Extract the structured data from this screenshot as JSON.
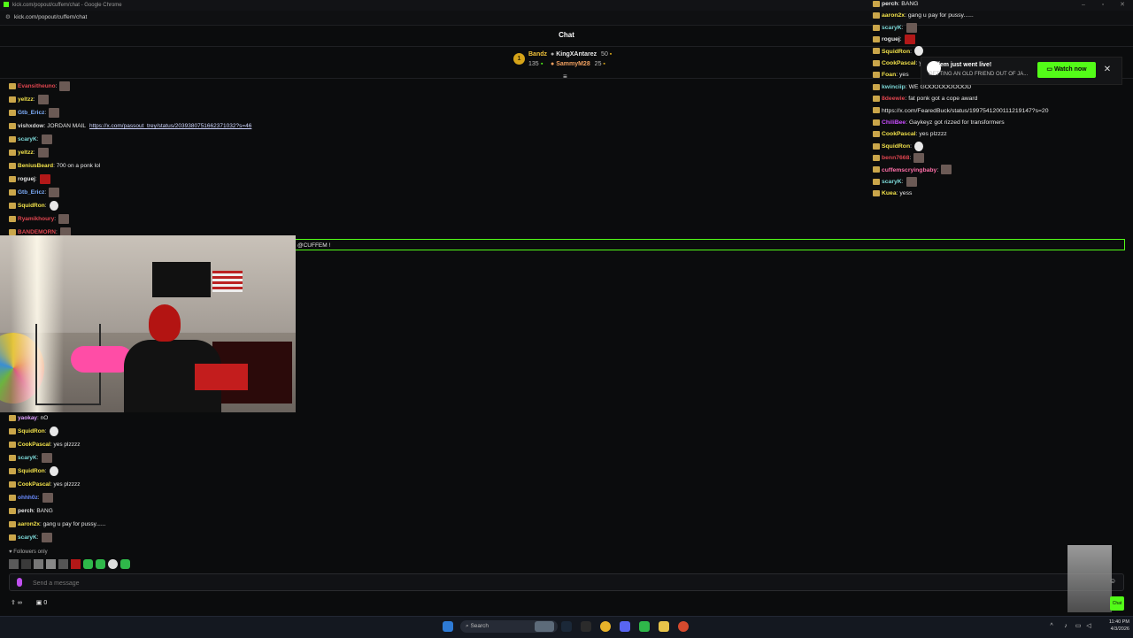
{
  "browser": {
    "window_title": "kick.com/popout/cuffem/chat - Google Chrome",
    "url": "kick.com/popout/cuffem/chat"
  },
  "chat": {
    "title": "Chat",
    "leaderboard": {
      "top": {
        "rank": "1",
        "name": "Bandz",
        "count": "135"
      },
      "entries": [
        {
          "name": "KingXAntarez",
          "count": "50"
        },
        {
          "name": "SammyM28",
          "count": "25"
        }
      ]
    },
    "messages_top": [
      {
        "user": "Evansitheuno",
        "user_color": "#e0454f",
        "text": ":",
        "emote": "face"
      },
      {
        "user": "yeltzz",
        "user_color": "#f0e04a",
        "text": ":",
        "emote": "face"
      },
      {
        "user": "Gtb_Ericz",
        "user_color": "#7fb0ff",
        "text": ":",
        "emote": "face"
      },
      {
        "user": "vishxdow",
        "user_color": "#d9d9d9",
        "text": "JORDAN MAIL",
        "link": "https://x.com/passout_trey/status/2039380751662371032?s=46"
      },
      {
        "user": "scaryK",
        "user_color": "#7dd9d9",
        "text": ":",
        "emote": "face"
      },
      {
        "user": "yeltzz",
        "user_color": "#f0e04a",
        "text": ":",
        "emote": "face"
      },
      {
        "user": "BeniusBeard",
        "user_color": "#f0e04a",
        "text": "700 on a ponk lol"
      },
      {
        "user": "roguej",
        "user_color": "#e8e8e8",
        "text": ":",
        "emote": "red"
      },
      {
        "user": "Gtb_Ericz",
        "user_color": "#7fb0ff",
        "text": ":",
        "emote": "face"
      },
      {
        "user": "SquidRon",
        "user_color": "#f0e04a",
        "text": ":",
        "emote": "skull"
      },
      {
        "user": "Ryamikhoury",
        "user_color": "#e0454f",
        "text": ":",
        "emote": "face"
      },
      {
        "user": "BANDEMORN",
        "user_color": "#e0454f",
        "text": ":",
        "emote": "face"
      }
    ],
    "reply_text": "@CUFFEM !",
    "messages_bottom": [
      {
        "user": "yaokay",
        "user_color": "#e0a0ff",
        "text": "nO"
      },
      {
        "user": "SquidRon",
        "user_color": "#f0e04a",
        "text": ":",
        "emote": "skull"
      },
      {
        "user": "CookPascal",
        "user_color": "#f0e04a",
        "text": "yes plzzzz"
      },
      {
        "user": "scaryK",
        "user_color": "#7dd9d9",
        "text": ":",
        "emote": "face"
      },
      {
        "user": "SquidRon",
        "user_color": "#f0e04a",
        "text": ":",
        "emote": "skull"
      },
      {
        "user": "CookPascal",
        "user_color": "#f0e04a",
        "text": "yes plzzzz"
      },
      {
        "user": "ohhh0z",
        "user_color": "#6a8cff",
        "text": ":",
        "emote": "face"
      },
      {
        "user": "perch",
        "user_color": "#e8e8e8",
        "text": "BANG"
      },
      {
        "user": "aaron2x",
        "user_color": "#f0e04a",
        "text": "gang u pay for pussy......"
      },
      {
        "user": "scaryK",
        "user_color": "#7dd9d9",
        "text": ":",
        "emote": "face"
      }
    ],
    "followers_only": "Followers only",
    "input_placeholder": "Send a message",
    "tools": {
      "link_icon": "∞",
      "gift_count": "0"
    },
    "send_label": "Chat"
  },
  "overlay_chat": {
    "messages": [
      {
        "user": "perch",
        "user_color": "#e8e8e8",
        "text": "BANG"
      },
      {
        "user": "aaron2x",
        "user_color": "#f0e04a",
        "text": "gang u pay for pussy......"
      },
      {
        "user": "scaryK",
        "user_color": "#7dd9d9",
        "text": ":",
        "emote": "face"
      },
      {
        "user": "roguej",
        "user_color": "#e8e8e8",
        "text": ":",
        "emote": "red"
      },
      {
        "user": "SquidRon",
        "user_color": "#f0e04a",
        "text": ":",
        "emote": "skull"
      },
      {
        "user": "CookPascal",
        "user_color": "#f0e04a",
        "text": "yes plzzzz"
      },
      {
        "user": "Foan",
        "user_color": "#f0e04a",
        "text": "yes"
      },
      {
        "user": "kwinciip",
        "user_color": "#7dd9d9",
        "text": "WE GOOOOOOOOOD"
      },
      {
        "user": "8deewie",
        "user_color": "#e0454f",
        "text": "fat ponk got a cope award"
      },
      {
        "user": "",
        "user_color": "#e8e8e8",
        "text": "https://x.com/FearedBuck/status/1997541200111219147?s=20"
      },
      {
        "user": "ChiliBee",
        "user_color": "#c94dff",
        "text": "Gaykeyz got rizzed for transformers"
      },
      {
        "user": "CookPascal",
        "user_color": "#f0e04a",
        "text": "yes plzzzz"
      },
      {
        "user": "SquidRon",
        "user_color": "#f0e04a",
        "text": ":",
        "emote": "skull"
      },
      {
        "user": "benn7668",
        "user_color": "#e0454f",
        "text": ":",
        "emote": "face"
      },
      {
        "user": "cuffemscryingbaby",
        "user_color": "#ff6fa8",
        "text": ":",
        "emote": "face"
      },
      {
        "user": "scaryK",
        "user_color": "#7dd9d9",
        "text": ":",
        "emote": "face"
      },
      {
        "user": "Kuea",
        "user_color": "#f0e04a",
        "text": "yess"
      }
    ],
    "toast": {
      "title": "cuffem just went live!",
      "subtitle": "GETTING AN OLD FRIEND OUT OF JA...",
      "button": "Watch now",
      "close": "✕"
    }
  },
  "taskbar": {
    "search_label": "Search",
    "time": "11:40 PM",
    "date": "4/3/2026"
  }
}
